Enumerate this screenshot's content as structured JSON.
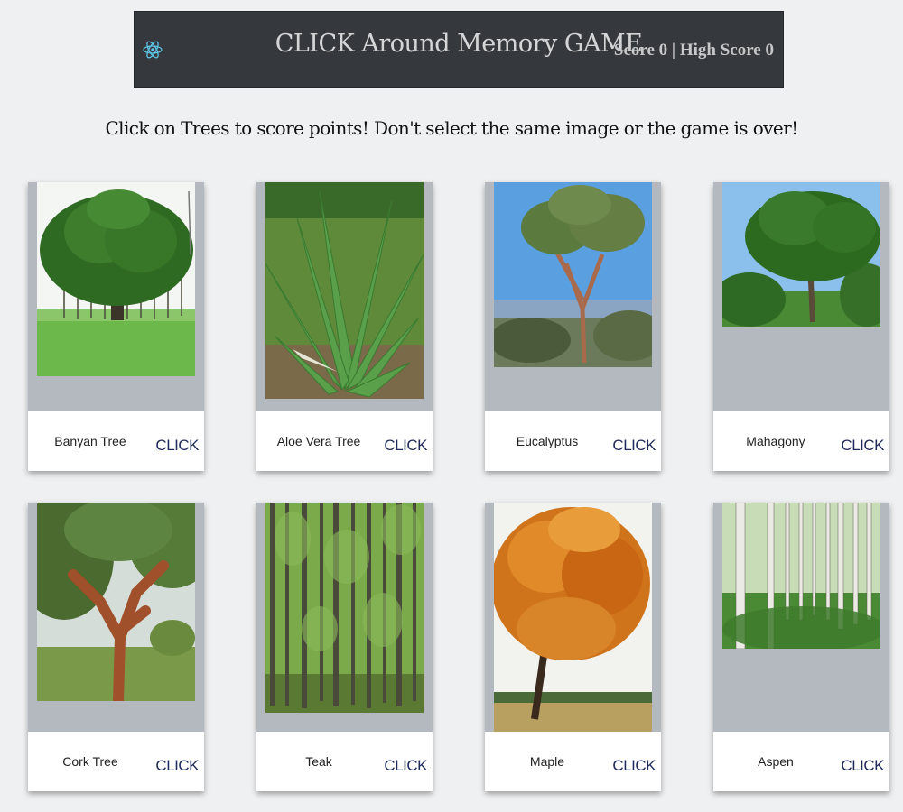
{
  "header": {
    "title": "CLICK Around Memory GAME",
    "score": "Score 0 | High Score 0",
    "logo_icon": "react-atom-icon",
    "bg_color": "#35383d"
  },
  "instructions": "Click on Trees to score points! Don't select the same image or the game is over!",
  "cards": [
    {
      "name": "Banyan Tree",
      "action": "CLICK",
      "image": "banyan-tree-image"
    },
    {
      "name": "Aloe Vera Tree",
      "action": "CLICK",
      "image": "aloe-vera-image"
    },
    {
      "name": "Eucalyptus",
      "action": "CLICK",
      "image": "eucalyptus-image"
    },
    {
      "name": "Mahagony",
      "action": "CLICK",
      "image": "mahagony-image"
    },
    {
      "name": "Cork Tree",
      "action": "CLICK",
      "image": "cork-tree-image"
    },
    {
      "name": "Teak",
      "action": "CLICK",
      "image": "teak-image"
    },
    {
      "name": "Maple",
      "action": "CLICK",
      "image": "maple-image"
    },
    {
      "name": "Aspen",
      "action": "CLICK",
      "image": "aspen-image"
    }
  ]
}
